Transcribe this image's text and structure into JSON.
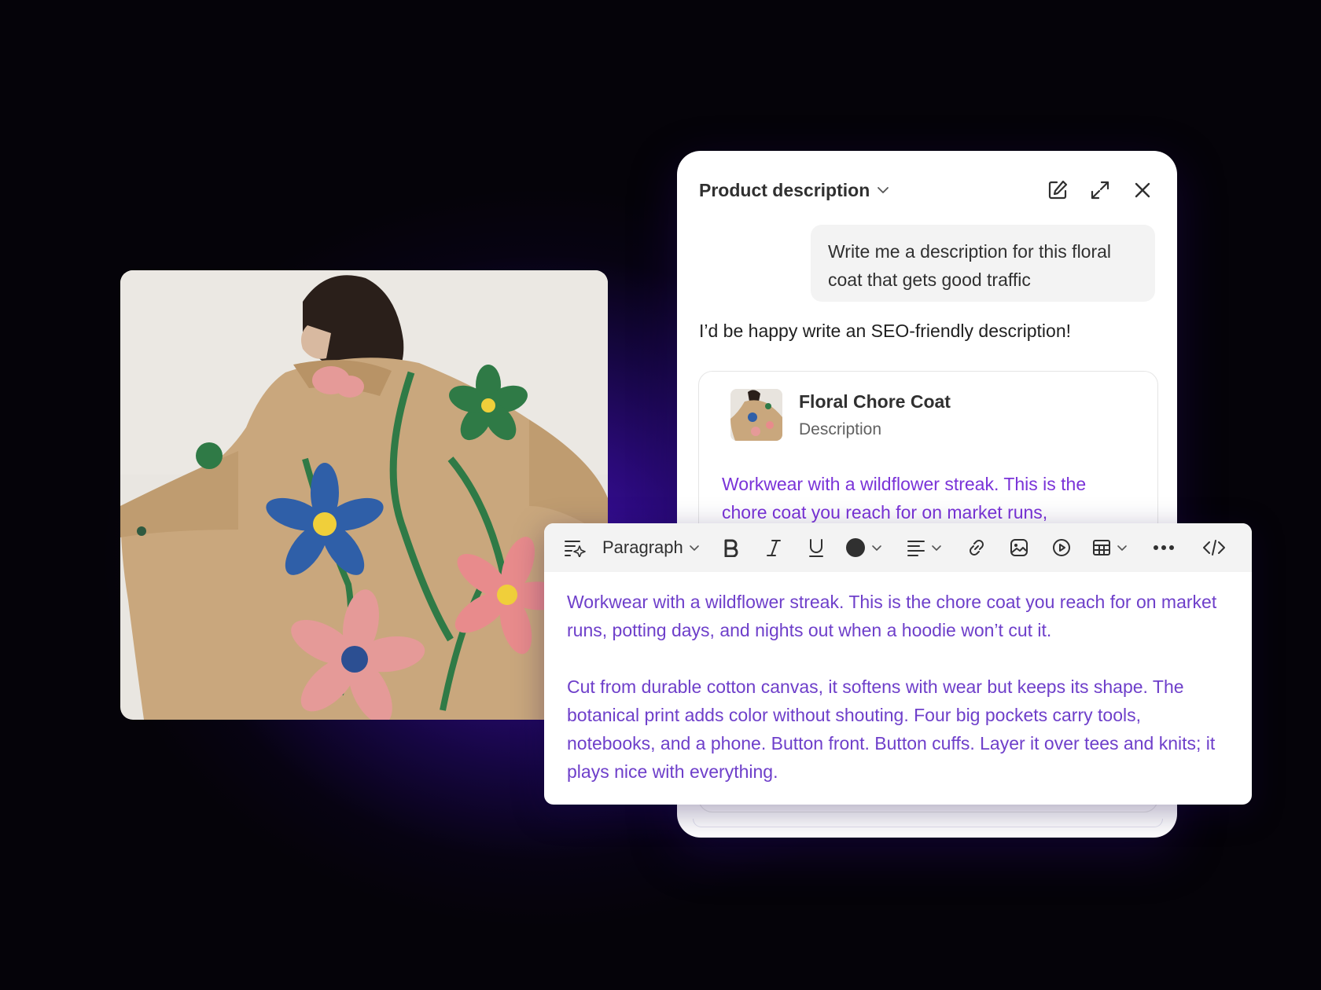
{
  "panel": {
    "title": "Product description",
    "user_message": "Write me a description for this floral coat that gets good traffic",
    "assistant_message": "I’d be happy write an SEO-friendly description!",
    "card": {
      "title": "Floral Chore Coat",
      "subtitle": "Description",
      "preview_text": "Workwear with a wildflower streak. This is the chore coat you reach for on market runs,"
    },
    "icons": [
      "edit-icon",
      "expand-icon",
      "close-icon"
    ]
  },
  "editor": {
    "block_type": "Paragraph",
    "toolbar_icons": [
      "ai-format-icon",
      "bold-icon",
      "italic-icon",
      "underline-icon",
      "text-color-icon",
      "align-icon",
      "link-icon",
      "image-icon",
      "video-icon",
      "table-icon",
      "more-icon",
      "code-icon"
    ],
    "paragraphs": [
      "Workwear with a wildflower streak. This is the chore coat you reach for on market runs, potting days, and nights out when a hoodie won’t cut it.",
      "Cut from durable cotton canvas, it softens with wear but keeps its shape. The botanical print adds color without shouting. Four big pockets carry tools, notebooks, and a phone. Button front. Button cuffs. Layer it over tees and knits; it plays nice with everything."
    ],
    "text_color": "#6e3fca"
  },
  "colors": {
    "background": "#070312",
    "glow": "#3d0fa8",
    "accent_text": "#7a33d8"
  }
}
